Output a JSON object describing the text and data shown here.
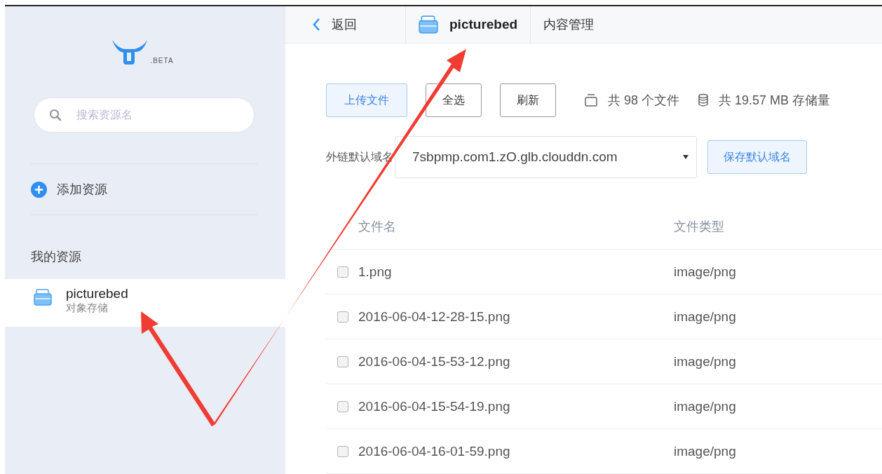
{
  "sidebar": {
    "logo_text": ".BETA",
    "search": {
      "placeholder": "搜索资源名"
    },
    "add_resource": "添加资源",
    "section_title": "我的资源",
    "resources": [
      {
        "name": "picturebed",
        "type": "对象存储",
        "selected": true
      }
    ]
  },
  "header": {
    "back": "返回",
    "bucket": "picturebed",
    "section": "内容管理"
  },
  "toolbar": {
    "buttons": [
      {
        "label": "上传文件",
        "kind": "primary"
      },
      {
        "label": "全选",
        "kind": "plain"
      },
      {
        "label": "刷新",
        "kind": "plain"
      }
    ],
    "file_count": "共 98 个文件",
    "storage": "共 19.57 MB 存储量"
  },
  "domain": {
    "label": "外链默认域名",
    "value": "7sbpmp.com1.zO.glb.clouddn.com",
    "save": "保存默认域名"
  },
  "table": {
    "columns": [
      "文件名",
      "文件类型"
    ],
    "rows": [
      {
        "name": "1.png",
        "type": "image/png",
        "checked": false
      },
      {
        "name": "2016-06-04-12-28-15.png",
        "type": "image/png",
        "checked": false
      },
      {
        "name": "2016-06-04-15-53-12.png",
        "type": "image/png",
        "checked": false
      },
      {
        "name": "2016-06-04-15-54-19.png",
        "type": "image/png",
        "checked": false
      },
      {
        "name": "2016-06-04-16-01-59.png",
        "type": "image/png",
        "checked": false
      }
    ]
  }
}
